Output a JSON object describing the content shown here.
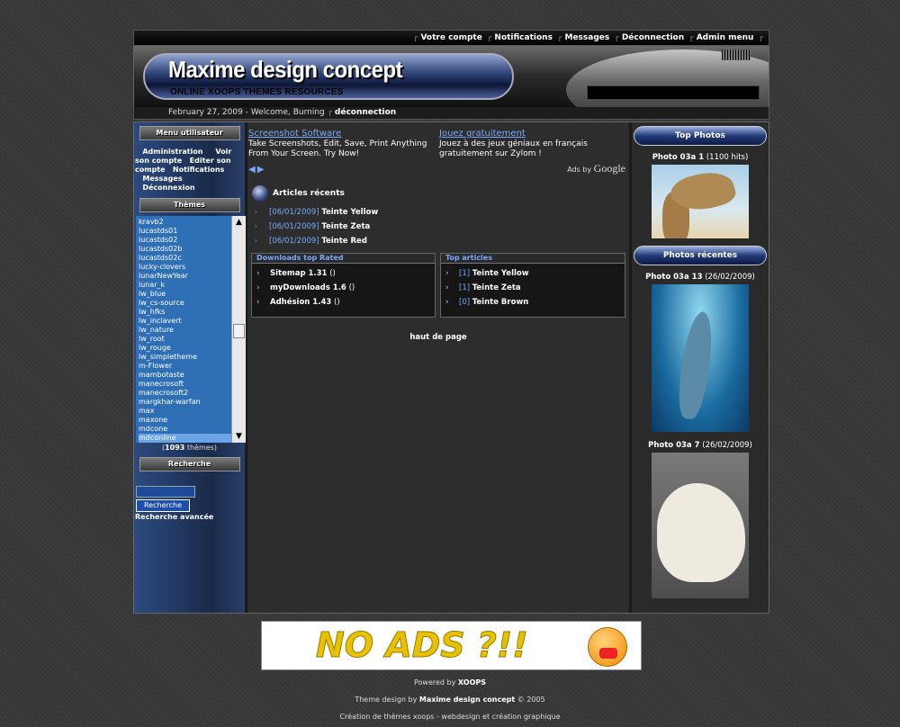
{
  "topnav": {
    "items": [
      "Votre compte",
      "Notifications",
      "Messages",
      "Déconnection",
      "Admin menu"
    ]
  },
  "banner": {
    "title": "Maxime design concept",
    "subtitle": "ONLINE XOOPS THEMES RESOURCES"
  },
  "datebar": {
    "date": "February 27, 2009",
    "welcome": "Welcome, Burning",
    "logout": "déconnection"
  },
  "left": {
    "user_menu_title": "Menu utilisateur",
    "user_menu": [
      "Administration",
      "Voir son compte",
      "Editer son compte",
      "Notifications",
      "Messages",
      "Déconnexion"
    ],
    "themes_title": "Thèmes",
    "themes": [
      "kravb2",
      "lucastds01",
      "lucastds02",
      "lucastds02b",
      "lucastds02c",
      "lucky-clovers",
      "lunarNewYear",
      "lunar_k",
      "lw_blue",
      "lw_cs-source",
      "lw_hfks",
      "lw_inclavert",
      "lw_nature",
      "lw_root",
      "lw_rouge",
      "lw_simpletheme",
      "m-Flower",
      "mambotaste",
      "manecrosoft",
      "manecrosoft2",
      "margkhar-warfan",
      "max",
      "maxone",
      "mdcone",
      "mdconline"
    ],
    "selected_theme": "mdconline",
    "theme_count": "1093",
    "theme_count_label": "thèmes",
    "search_title": "Recherche",
    "search_button": "Recherche",
    "advanced_search": "Recherche avancée"
  },
  "ads": {
    "ad1_title": "Screenshot Software",
    "ad1_text": "Take Screenshots, Edit, Save, Print Anything From Your Screen. Try Now!",
    "ad2_title": "Jouez gratuitement",
    "ad2_text": "Jouez à des jeux géniaux en français gratuitement sur Zylom !",
    "ads_by": "Ads by",
    "google": "Google"
  },
  "recent_articles": {
    "title": "Articles récents",
    "items": [
      {
        "date": "[06/01/2009]",
        "title": "Teinte Yellow"
      },
      {
        "date": "[06/01/2009]",
        "title": "Teinte Zeta"
      },
      {
        "date": "[06/01/2009]",
        "title": "Teinte Red"
      }
    ]
  },
  "downloads": {
    "title": "Downloads top Rated",
    "items": [
      {
        "name": "Sitemap 1.31",
        "rating": "()"
      },
      {
        "name": "myDownloads 1.6",
        "rating": "()"
      },
      {
        "name": "Adhésion 1.43",
        "rating": "()"
      }
    ]
  },
  "top_articles": {
    "title": "Top articles",
    "items": [
      {
        "count": "[1]",
        "title": "Teinte Yellow"
      },
      {
        "count": "[1]",
        "title": "Teinte Zeta"
      },
      {
        "count": "[0]",
        "title": "Teinte Brown"
      }
    ]
  },
  "haut_de_page": "haut de page",
  "right": {
    "top_photos_title": "Top Photos",
    "top_photo_caption": "Photo 03a 1",
    "top_photo_hits": "(1100 hits)",
    "recent_photos_title": "Photos récentes",
    "recent1_caption": "Photo 03a 13",
    "recent1_date": "(26/02/2009)",
    "recent2_caption": "Photo 03a 7",
    "recent2_date": "(26/02/2009)"
  },
  "footer": {
    "banner_text": "NO ADS ?!!",
    "powered_prefix": "Powered by",
    "powered_brand": "XOOPS",
    "design_prefix": "Theme design by",
    "design_brand": "Maxime design concept",
    "design_suffix": "© 2005",
    "tagline": "Création de thèmes xoops - webdesign et création graphique"
  }
}
